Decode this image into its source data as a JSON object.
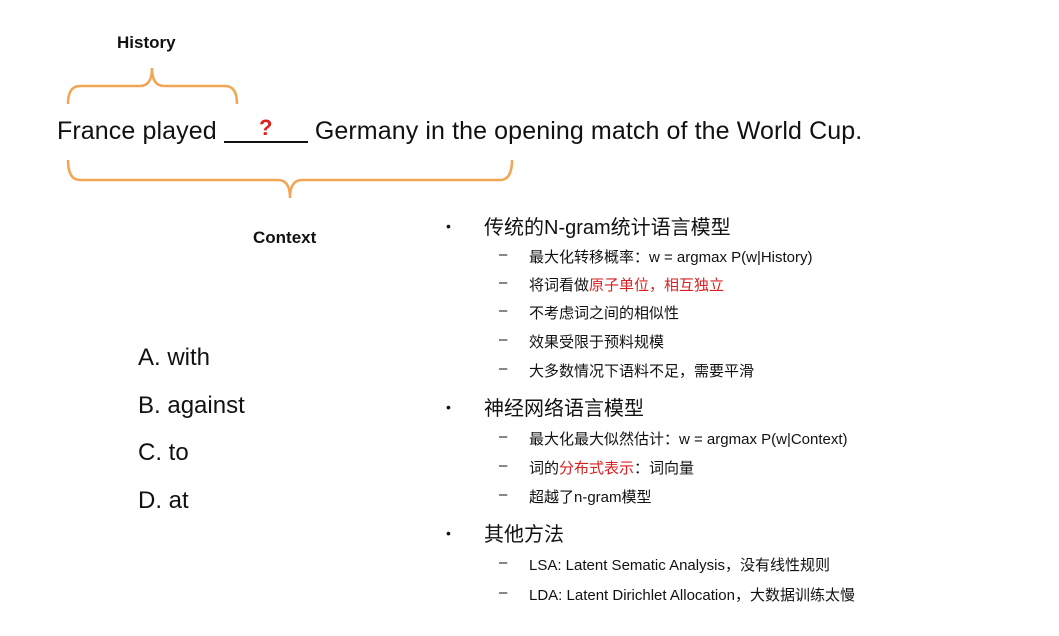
{
  "labels": {
    "history": "History",
    "context": "Context"
  },
  "sentence": {
    "before": "France played ",
    "blank_mark": "?",
    "after": " Germany in the opening match of the World Cup."
  },
  "options": [
    "A. with",
    "B. against",
    "C. to",
    "D. at"
  ],
  "bullets": {
    "b1": {
      "title": "传统的N-gram统计语言模型",
      "s1": "最大化转移概率：w = argmax P(w|History)",
      "s2_pre": "将词看做",
      "s2_red": "原子单位，相互独立",
      "s3": "不考虑词之间的相似性",
      "s4": "效果受限于预料规模",
      "s5": "大多数情况下语料不足，需要平滑"
    },
    "b2": {
      "title": "神经网络语言模型",
      "s1": "最大化最大似然估计：w = argmax  P(w|Context)",
      "s2_pre": "词的",
      "s2_red": "分布式表示",
      "s2_post": "：词向量",
      "s3": "超越了n-gram模型"
    },
    "b3": {
      "title": "其他方法",
      "s1": "LSA: Latent Sematic Analysis，没有线性规则",
      "s2": "LDA: Latent Dirichlet Allocation，大数据训练太慢"
    }
  },
  "markers": {
    "bullet": "•",
    "dash": "–"
  },
  "colors": {
    "bracket": "#f2a654",
    "highlight": "#d92020",
    "question": "#e02020"
  }
}
